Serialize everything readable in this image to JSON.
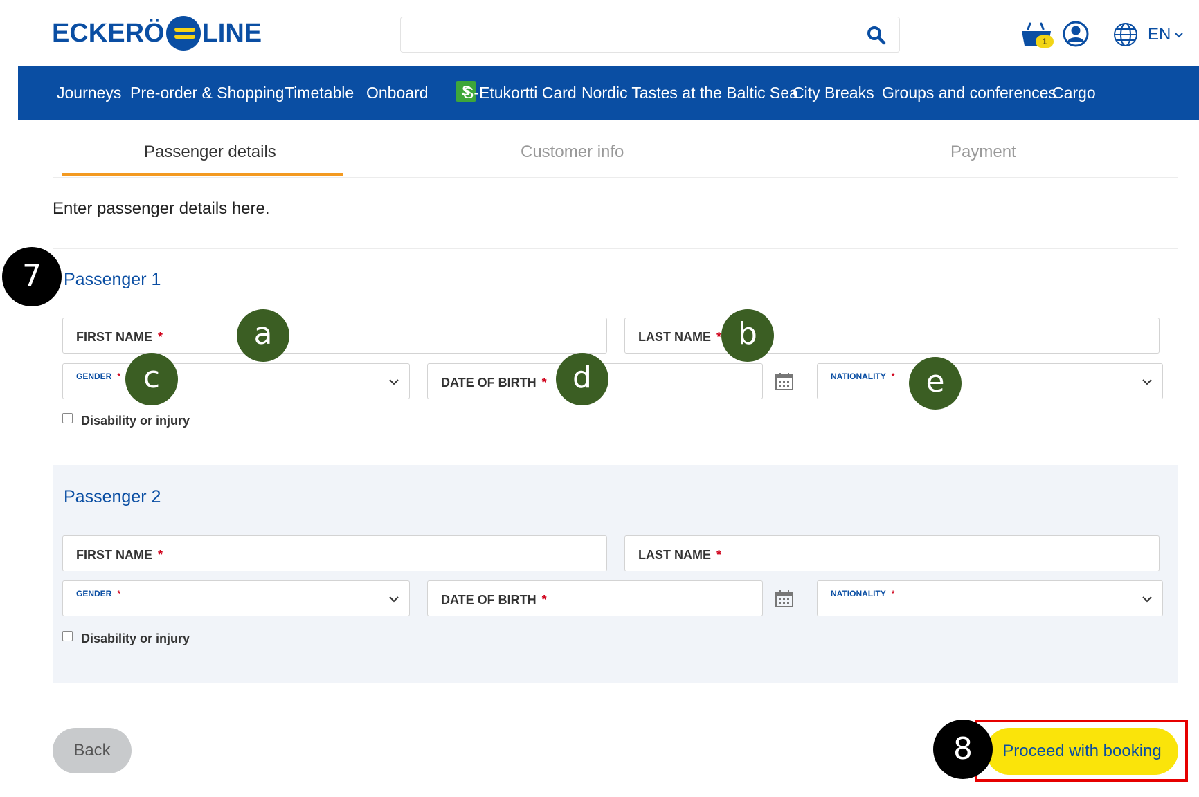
{
  "header": {
    "logo_left": "ECKERÖ",
    "logo_right": "LINE",
    "search": {
      "placeholder": "",
      "value": ""
    },
    "cart_count": "1",
    "language": "EN"
  },
  "nav": {
    "items": [
      "Journeys",
      "Pre-order & Shopping",
      "Timetable",
      "Onboard",
      "S-Etukortti Card",
      "Nordic Tastes at the Baltic Sea",
      "City Breaks",
      "Groups and conferences",
      "Cargo"
    ],
    "s_badge": "S"
  },
  "steps": {
    "items": [
      "Passenger details",
      "Customer info",
      "Payment"
    ],
    "active": "Passenger details"
  },
  "intro": "Enter passenger details here.",
  "passengers": [
    {
      "title": "Passenger 1",
      "first_name": "FIRST NAME",
      "last_name": "LAST NAME",
      "gender": "GENDER",
      "date_of_birth": "DATE OF BIRTH",
      "nationality": "NATIONALITY",
      "disability": "Disability or injury",
      "required_mark": "*"
    },
    {
      "title": "Passenger 2",
      "first_name": "FIRST NAME",
      "last_name": "LAST NAME",
      "gender": "GENDER",
      "date_of_birth": "DATE OF BIRTH",
      "nationality": "NATIONALITY",
      "disability": "Disability or injury",
      "required_mark": "*"
    }
  ],
  "buttons": {
    "back": "Back",
    "proceed": "Proceed with booking"
  },
  "annotations": {
    "passenger_section": "7",
    "proceed": "8",
    "first_name": "a",
    "last_name": "b",
    "gender": "c",
    "date_of_birth": "d",
    "nationality": "e"
  },
  "colors": {
    "brand_blue": "#0a4ea3",
    "tab_accent": "#f39a21",
    "proceed_yellow": "#fae40a",
    "highlight_red": "#e60000",
    "annotation_green": "#3b5e23"
  }
}
